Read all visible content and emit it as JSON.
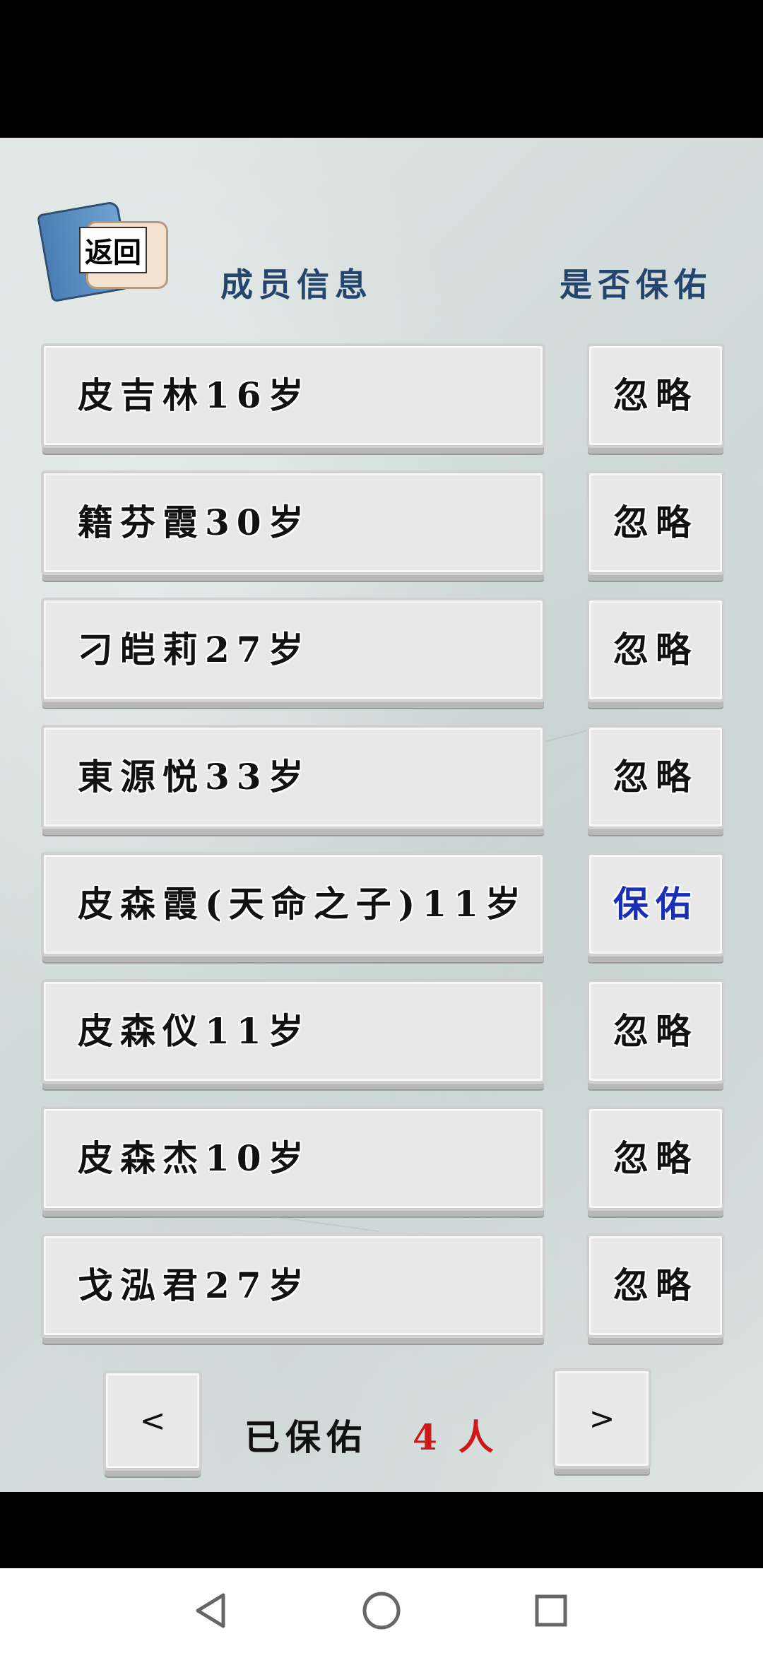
{
  "header": {
    "back_label": "返回",
    "col_member": "成员信息",
    "col_status": "是否保佑"
  },
  "members": [
    {
      "name": "皮吉林16岁",
      "status": "忽略"
    },
    {
      "name": "籍芬霞30岁",
      "status": "忽略"
    },
    {
      "name": "刁皑莉27岁",
      "status": "忽略"
    },
    {
      "name": "東源悦33岁",
      "status": "忽略"
    },
    {
      "name": "皮森霞(天命之子)11岁",
      "status": "保佑"
    },
    {
      "name": "皮森仪11岁",
      "status": "忽略"
    },
    {
      "name": "皮森杰10岁",
      "status": "忽略"
    },
    {
      "name": "戈泓君27岁",
      "status": "忽略"
    }
  ],
  "footer": {
    "prev_label": "<",
    "next_label": ">",
    "blessed_label": "已保佑",
    "blessed_count": "4",
    "count_unit": "人"
  },
  "colors": {
    "header": "#24456e",
    "blessed_status": "#1a2fb8",
    "count": "#d01818"
  },
  "icons": {
    "back": "book-scroll-icon",
    "nav_back": "triangle-back-icon",
    "nav_home": "circle-home-icon",
    "nav_recent": "square-recents-icon"
  }
}
